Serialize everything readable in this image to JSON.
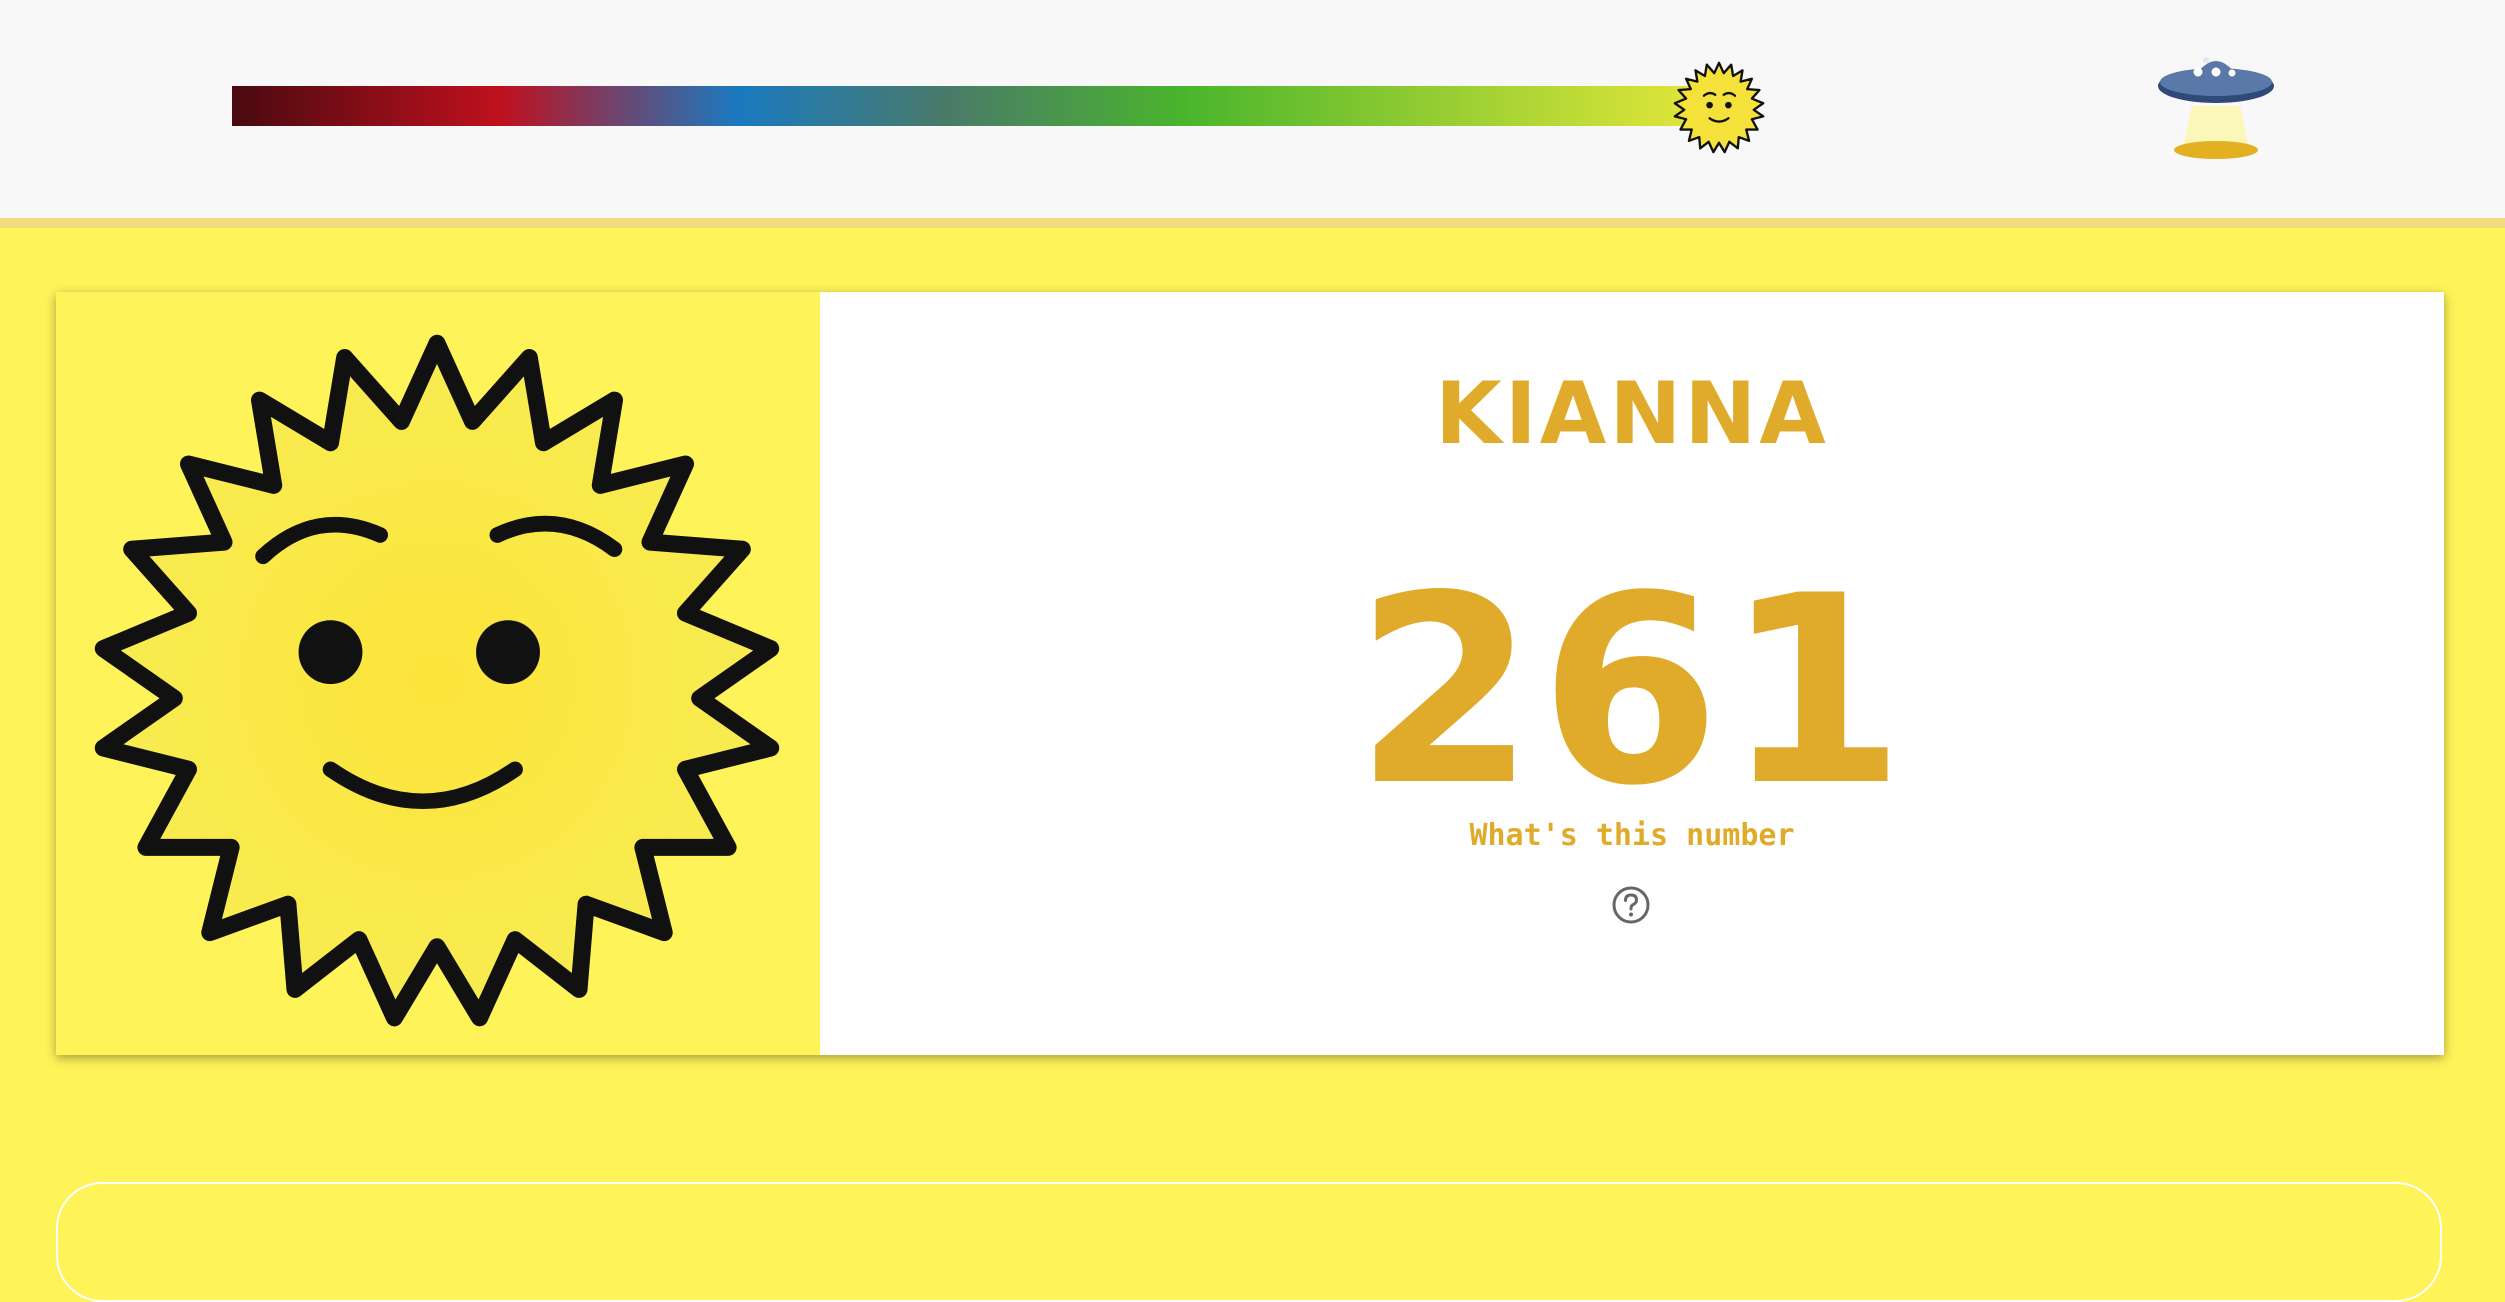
{
  "header": {
    "scale_marker_icon": "sun-face-icon",
    "scale_position": 0.94,
    "scale_colors": [
      "#4a0a10",
      "#c0101e",
      "#1a7ac0",
      "#4ab52c",
      "#e8e83a"
    ],
    "menu_icon": "ufo-icon"
  },
  "profile": {
    "avatar_icon": "smiling-sun-icon",
    "name": "KIANNA",
    "number": "261",
    "number_help_label": "What's this number",
    "help_icon": "question-circle-icon"
  },
  "colors": {
    "background": "#fff35a",
    "accent": "#e0ab2a",
    "header_bg": "#f8f8f8"
  }
}
